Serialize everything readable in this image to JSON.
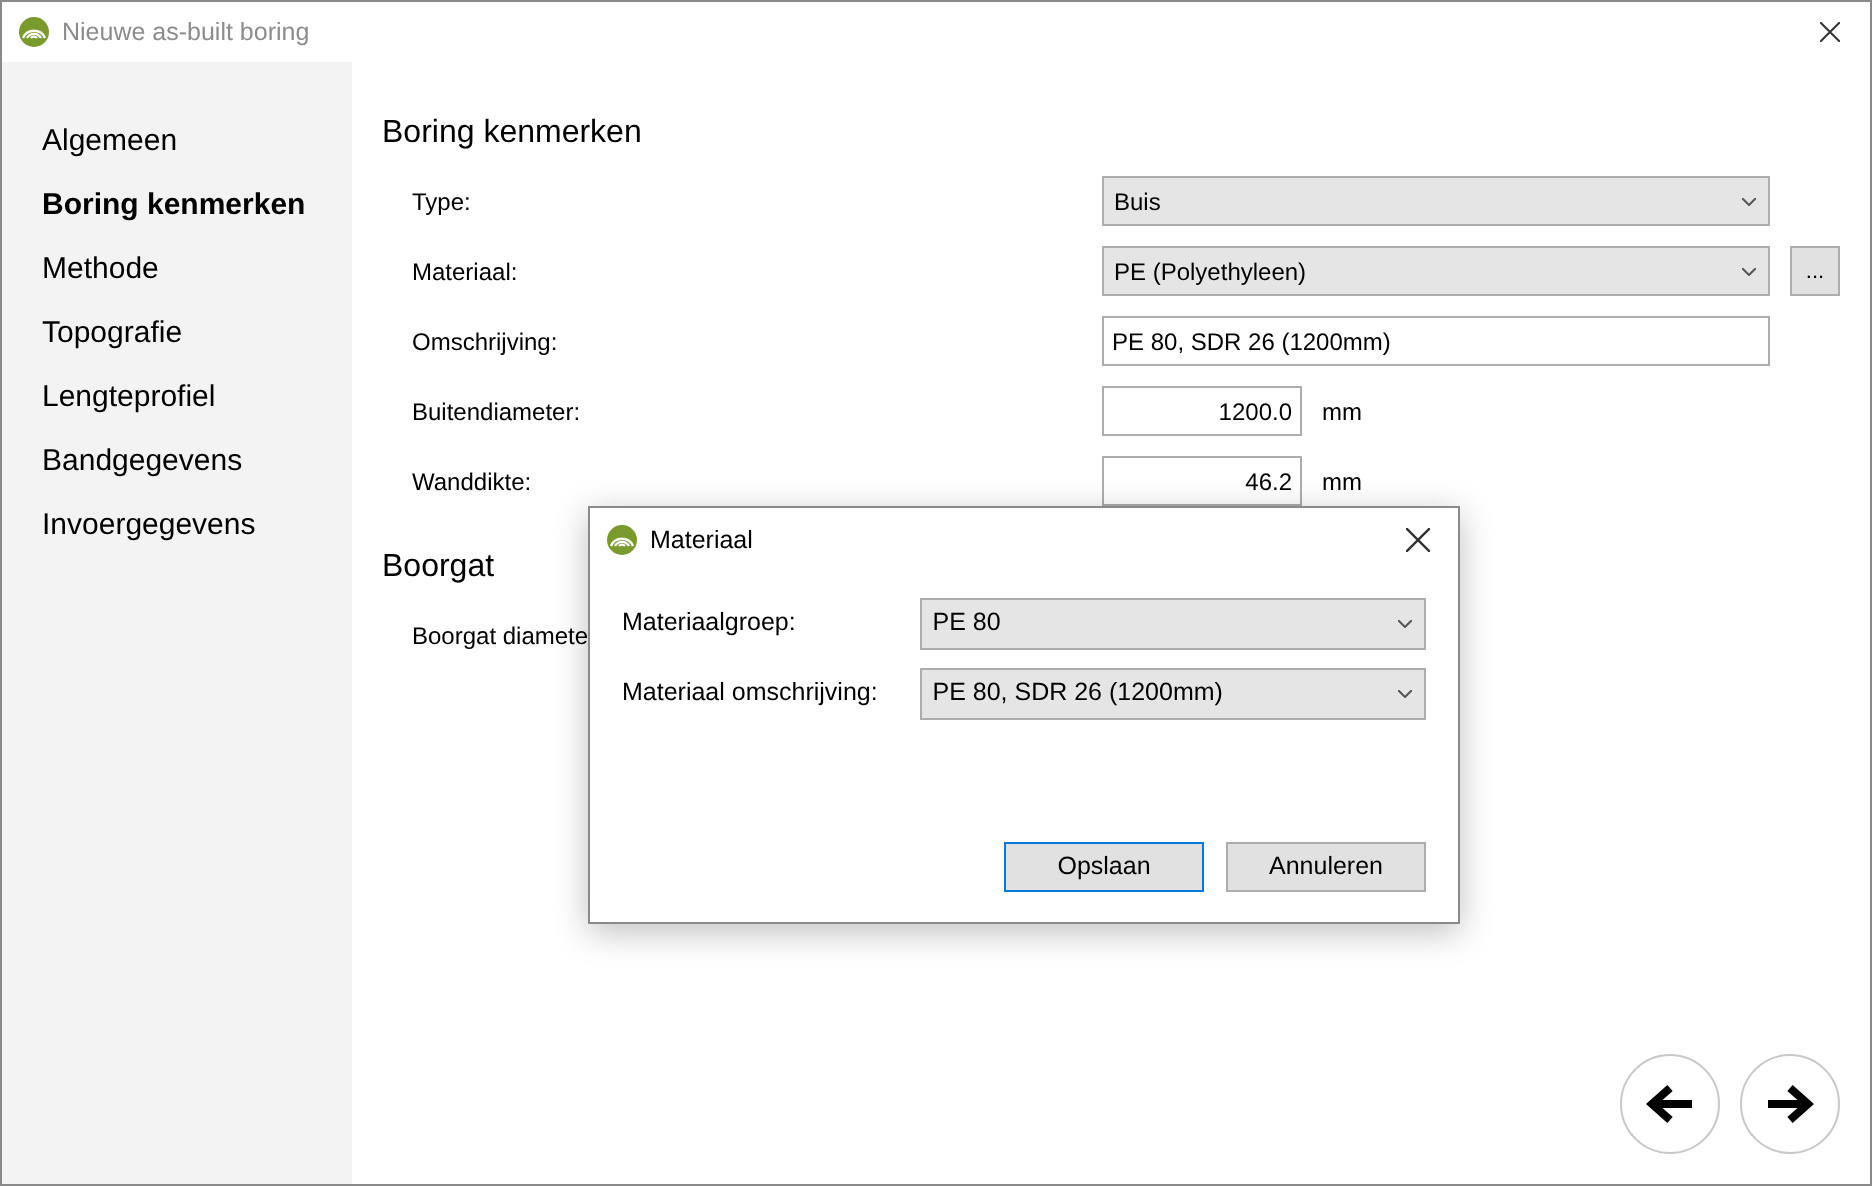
{
  "window": {
    "title": "Nieuwe as-built boring"
  },
  "sidebar": {
    "items": [
      {
        "label": "Algemeen",
        "selected": false
      },
      {
        "label": "Boring kenmerken",
        "selected": true
      },
      {
        "label": "Methode",
        "selected": false
      },
      {
        "label": "Topografie",
        "selected": false
      },
      {
        "label": "Lengteprofiel",
        "selected": false
      },
      {
        "label": "Bandgegevens",
        "selected": false
      },
      {
        "label": "Invoergegevens",
        "selected": false
      }
    ]
  },
  "sections": [
    {
      "heading": "Boring kenmerken",
      "fields": [
        {
          "label": "Type:",
          "kind": "dropdown",
          "value": "Buis"
        },
        {
          "label": "Materiaal:",
          "kind": "dropdown",
          "value": "PE (Polyethyleen)",
          "browse_button": "..."
        },
        {
          "label": "Omschrijving:",
          "kind": "text",
          "value": "PE 80, SDR 26 (1200mm)"
        },
        {
          "label": "Buitendiameter:",
          "kind": "number",
          "value": "1200.0",
          "unit": "mm"
        },
        {
          "label": "Wanddikte:",
          "kind": "number",
          "value": "46.2",
          "unit": "mm"
        }
      ]
    },
    {
      "heading": "Boorgat",
      "fields": [
        {
          "label": "Boorgat diamete",
          "kind": "hidden"
        }
      ]
    }
  ],
  "dialog": {
    "title": "Materiaal",
    "fields": [
      {
        "label": "Materiaalgroep:",
        "value": "PE 80"
      },
      {
        "label": "Materiaal omschrijving:",
        "value": "PE 80, SDR 26 (1200mm)"
      }
    ],
    "buttons": [
      {
        "label": "Opslaan",
        "default": true
      },
      {
        "label": "Annuleren",
        "default": false
      }
    ]
  }
}
